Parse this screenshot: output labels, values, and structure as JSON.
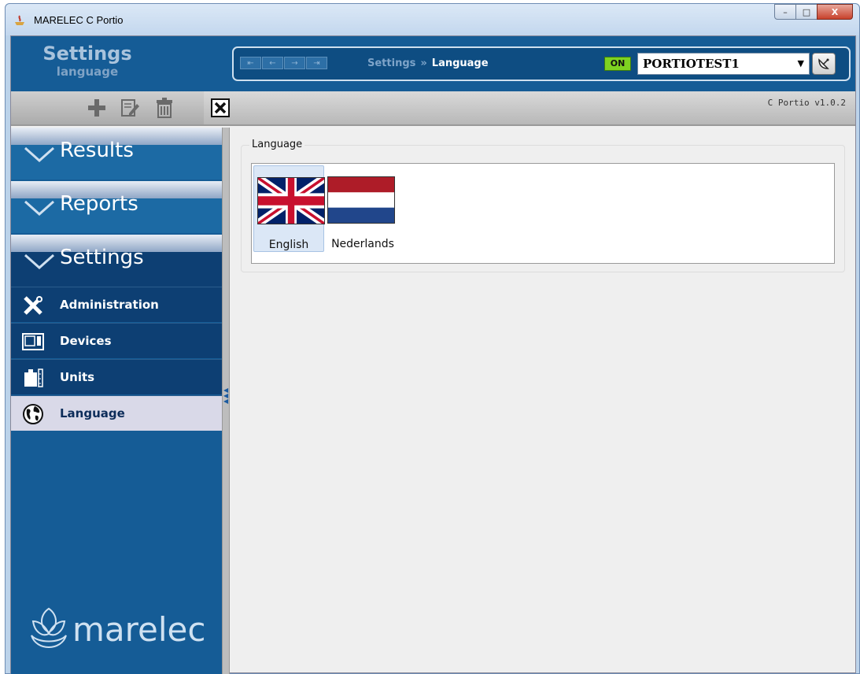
{
  "window": {
    "title": "MARELEC C Portio",
    "minimize_glyph": "–",
    "maximize_glyph": "□",
    "close_glyph": "X"
  },
  "header": {
    "title": "Settings",
    "subtitle": "language",
    "breadcrumb": {
      "parent": "Settings",
      "separator": "»",
      "current": "Language"
    },
    "nav_arrows": [
      "⇤",
      "←",
      "→",
      "⇥"
    ],
    "status_badge": "ON",
    "status_color": "#7ed321",
    "device": {
      "selected": "PORTIOTEST1"
    }
  },
  "toolbar": {
    "buttons": [
      "add-icon",
      "edit-icon",
      "delete-icon",
      "close-icon"
    ],
    "version": "C Portio v1.0.2"
  },
  "sidebar": {
    "sections": [
      {
        "label": "Results",
        "expanded": false
      },
      {
        "label": "Reports",
        "expanded": false
      },
      {
        "label": "Settings",
        "expanded": true
      }
    ],
    "items": [
      {
        "label": "Administration",
        "icon": "wrench-screwdriver-icon",
        "active": false
      },
      {
        "label": "Devices",
        "icon": "device-icon",
        "active": false
      },
      {
        "label": "Units",
        "icon": "weight-icon",
        "active": false
      },
      {
        "label": "Language",
        "icon": "globe-icon",
        "active": true
      }
    ],
    "logo_text": "marelec"
  },
  "content": {
    "group_title": "Language",
    "languages": [
      {
        "name": "English",
        "flag": "uk-flag-icon",
        "selected": true
      },
      {
        "name": "Nederlands",
        "flag": "nl-flag-icon",
        "selected": false
      }
    ]
  },
  "colors": {
    "header_bg": "#155c96",
    "sidebar_bg": "#155c96",
    "active_item_bg": "#d9d9e8"
  }
}
